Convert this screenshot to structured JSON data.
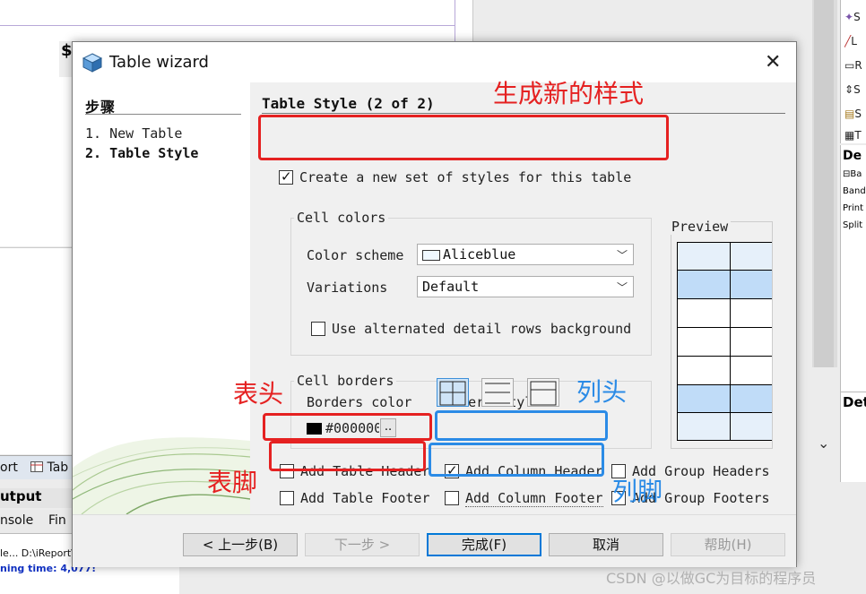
{
  "background": {
    "dollar": "$",
    "tabs": [
      "ort",
      "Tab"
    ],
    "output_title": "utput",
    "console_tabs": [
      "nsole",
      "Fin"
    ],
    "log_line1": "le... D:\\iReport\\",
    "log_line2": "ning time: 4,077!",
    "palette_items": [
      "S",
      "L",
      "R",
      "S",
      "S",
      "T"
    ],
    "props_header": "De",
    "props_rows": [
      "Ba",
      "Band",
      "Print",
      "Split"
    ],
    "props2_header": "Det"
  },
  "dialog": {
    "title": "Table wizard",
    "close_label": "✕",
    "steps": {
      "title": "步骤",
      "items": [
        "1. New Table",
        "2. Table Style"
      ]
    },
    "section_title": "Table Style (2 of 2)",
    "create_styles": {
      "label": "Create a new set of styles for this table",
      "checked": true
    },
    "cell_colors": {
      "title": "Cell colors",
      "color_scheme_label": "Color scheme",
      "color_scheme_value": "Aliceblue",
      "variations_label": "Variations",
      "variations_value": "Default",
      "alternated_label": "Use alternated detail rows background",
      "alternated_checked": false
    },
    "preview_title": "Preview",
    "cell_borders": {
      "title": "Cell borders",
      "borders_color_label": "Borders color",
      "borders_color_value": "#000000",
      "borders_color_button": "..",
      "borders_style_label": "Borders style"
    },
    "options": {
      "add_table_header": {
        "label": "Add Table Header",
        "checked": false
      },
      "add_table_footer": {
        "label": "Add Table Footer",
        "checked": false
      },
      "add_column_header": {
        "label": "Add Column Header",
        "checked": true
      },
      "add_column_footer": {
        "label": "Add Column Footer",
        "checked": false
      },
      "add_group_headers": {
        "label": "Add Group Headers",
        "checked": false
      },
      "add_group_footers": {
        "label": "Add Group Footers",
        "checked": false
      }
    },
    "buttons": {
      "back": "< 上一步(B)",
      "next": "下一步 >",
      "finish": "完成(F)",
      "cancel": "取消",
      "help": "帮助(H)"
    }
  },
  "annotations": {
    "new_style": "生成新的样式",
    "table_header": "表头",
    "table_footer": "表脚",
    "column_header": "列头",
    "column_footer": "列脚"
  },
  "watermark": "CSDN @以做GC为目标的程序员",
  "colors": {
    "annotation_red": "#e52121",
    "annotation_blue": "#2b8be6",
    "preview_highlight": "#c0dcf8",
    "preview_light": "#e6f0fa",
    "default_button_border": "#0078d7"
  }
}
